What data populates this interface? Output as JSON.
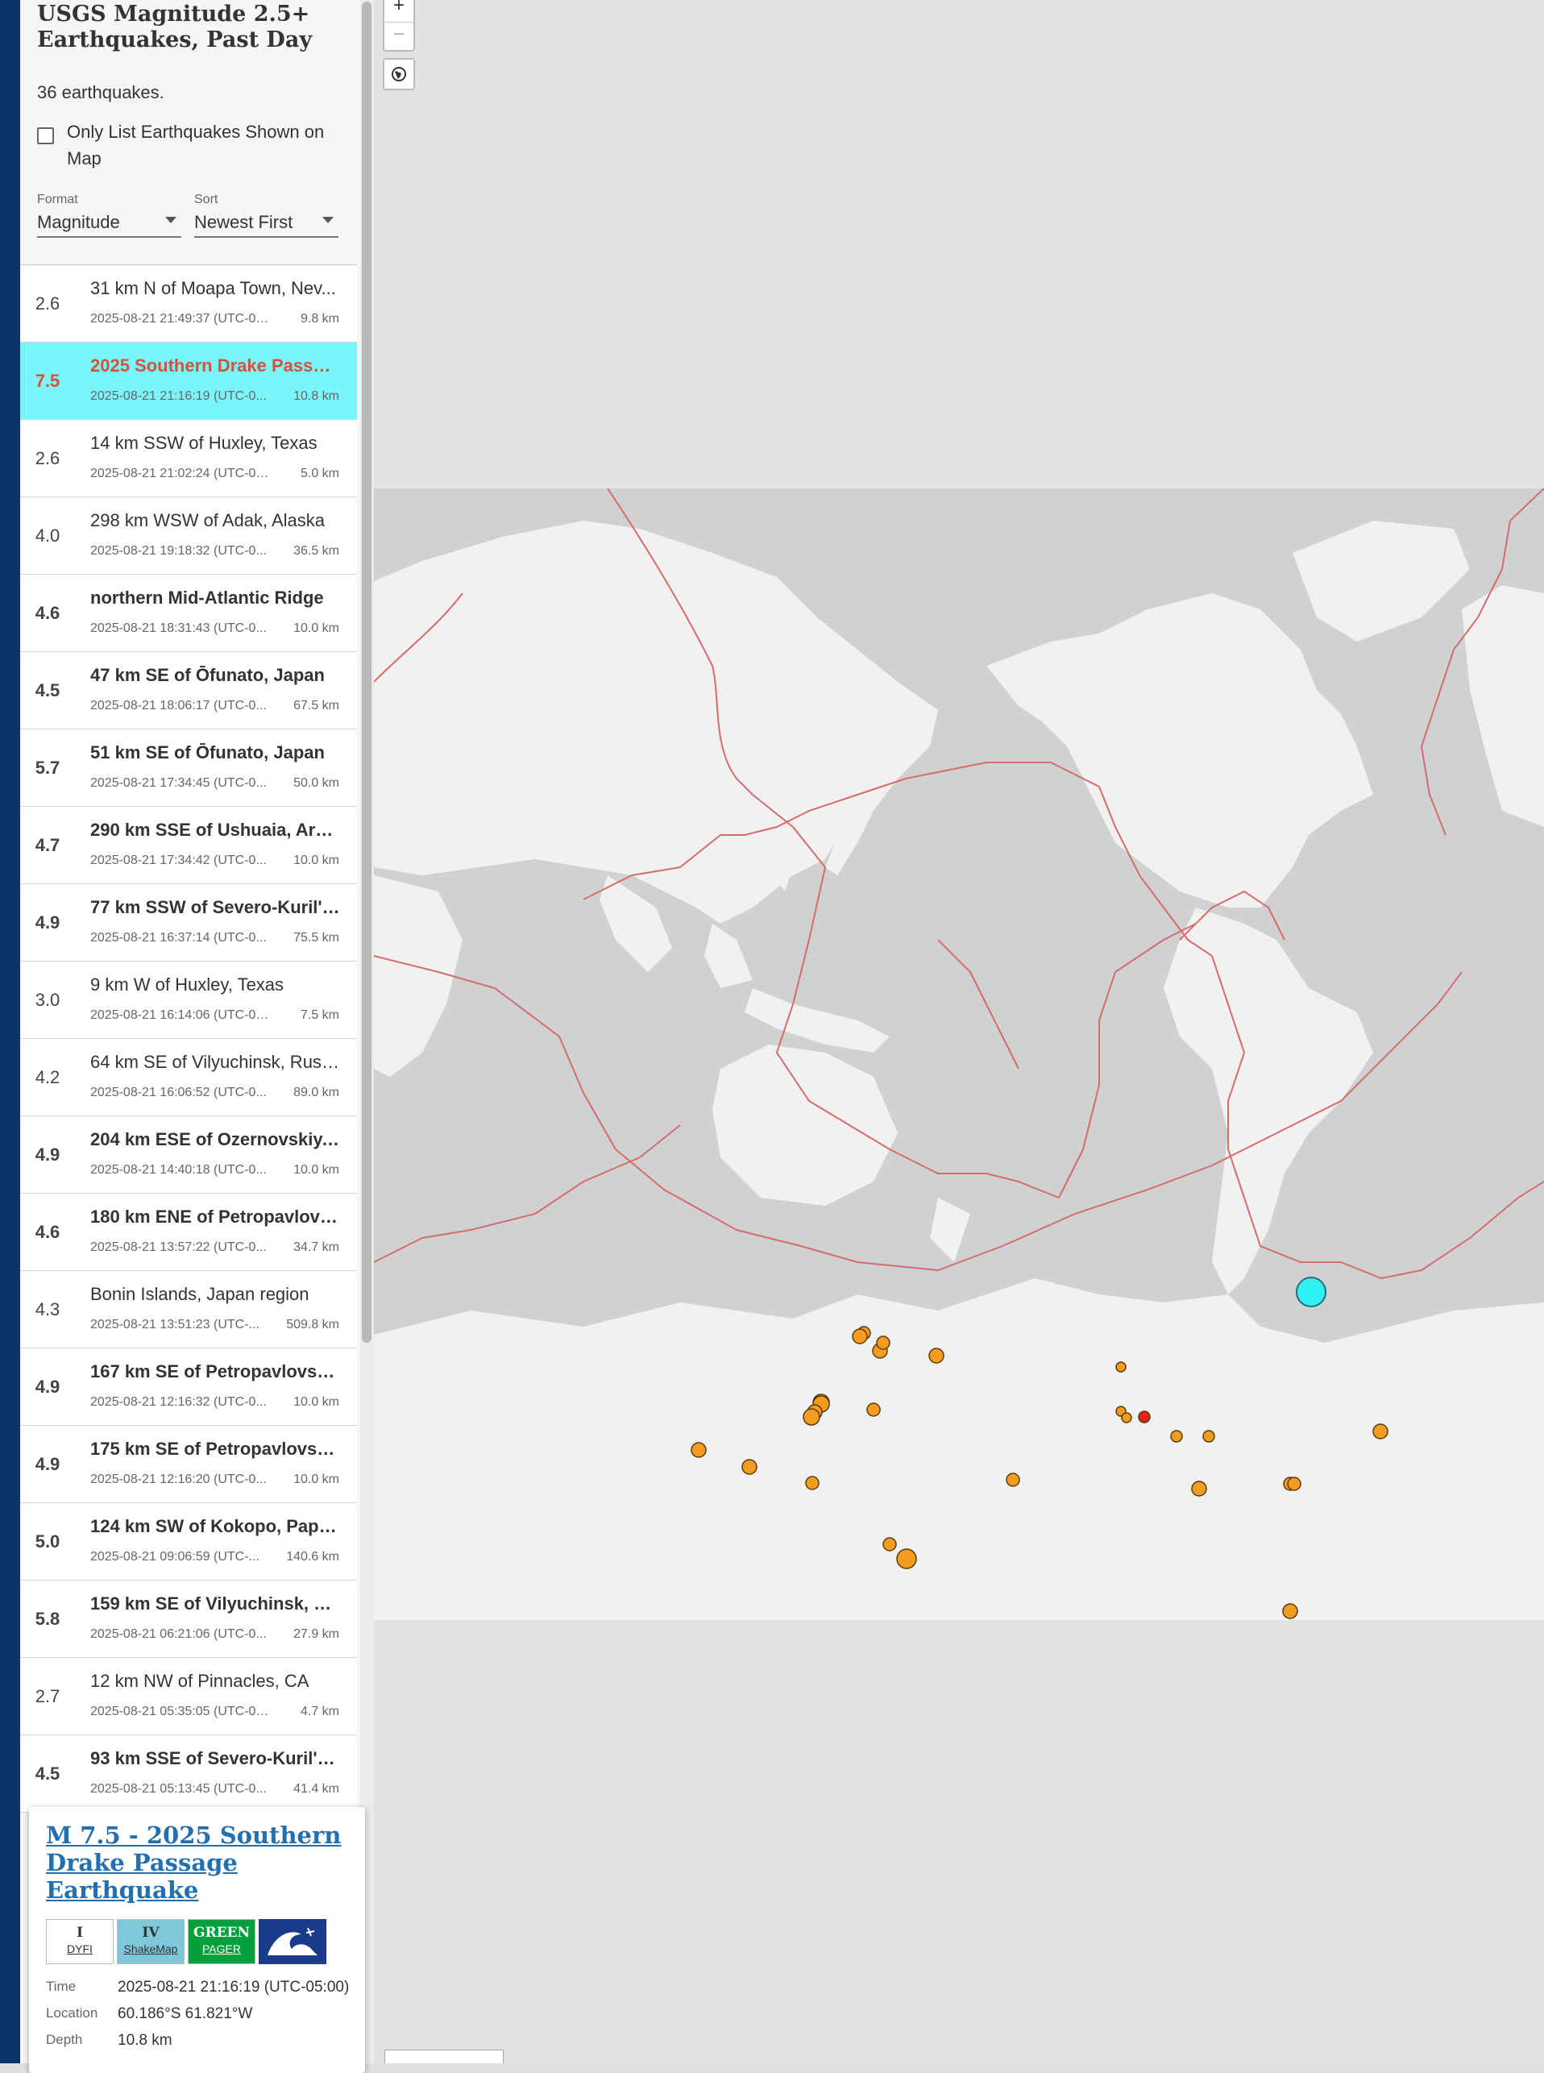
{
  "sidebar": {
    "title": "USGS Magnitude 2.5+ Earthquakes, Past Day",
    "count_text": "36 earthquakes.",
    "filter_label": "Only List Earthquakes Shown on Map",
    "format": {
      "label": "Format",
      "value": "Magnitude"
    },
    "sort": {
      "label": "Sort",
      "value": "Newest First"
    }
  },
  "earthquakes": [
    {
      "mag": "2.6",
      "place": "31 km N of Moapa Town, Nev...",
      "time": "2025-08-21 21:49:37 (UTC-05:...",
      "depth": "9.8 km"
    },
    {
      "mag": "7.5",
      "place": "2025 Southern Drake Passag...",
      "time": "2025-08-21 21:16:19 (UTC-0...",
      "depth": "10.8 km"
    },
    {
      "mag": "2.6",
      "place": "14 km SSW of Huxley, Texas",
      "time": "2025-08-21 21:02:24 (UTC-05:...",
      "depth": "5.0 km"
    },
    {
      "mag": "4.0",
      "place": "298 km WSW of Adak, Alaska",
      "time": "2025-08-21 19:18:32 (UTC-0...",
      "depth": "36.5 km"
    },
    {
      "mag": "4.6",
      "place": "northern Mid-Atlantic Ridge",
      "time": "2025-08-21 18:31:43 (UTC-0...",
      "depth": "10.0 km"
    },
    {
      "mag": "4.5",
      "place": "47 km SE of Ōfunato, Japan",
      "time": "2025-08-21 18:06:17 (UTC-0...",
      "depth": "67.5 km"
    },
    {
      "mag": "5.7",
      "place": "51 km SE of Ōfunato, Japan",
      "time": "2025-08-21 17:34:45 (UTC-0...",
      "depth": "50.0 km"
    },
    {
      "mag": "4.7",
      "place": "290 km SSE of Ushuaia, Arge...",
      "time": "2025-08-21 17:34:42 (UTC-0...",
      "depth": "10.0 km"
    },
    {
      "mag": "4.9",
      "place": "77 km SSW of Severo-Kuril's...",
      "time": "2025-08-21 16:37:14 (UTC-0...",
      "depth": "75.5 km"
    },
    {
      "mag": "3.0",
      "place": "9 km W of Huxley, Texas",
      "time": "2025-08-21 16:14:06 (UTC-05:...",
      "depth": "7.5 km"
    },
    {
      "mag": "4.2",
      "place": "64 km SE of Vilyuchinsk, Russia",
      "time": "2025-08-21 16:06:52 (UTC-0...",
      "depth": "89.0 km"
    },
    {
      "mag": "4.9",
      "place": "204 km ESE of Ozernovskiy, ...",
      "time": "2025-08-21 14:40:18 (UTC-0...",
      "depth": "10.0 km"
    },
    {
      "mag": "4.6",
      "place": "180 km ENE of Petropavlovsk...",
      "time": "2025-08-21 13:57:22 (UTC-0...",
      "depth": "34.7 km"
    },
    {
      "mag": "4.3",
      "place": "Bonin Islands, Japan region",
      "time": "2025-08-21 13:51:23 (UTC-...",
      "depth": "509.8 km"
    },
    {
      "mag": "4.9",
      "place": "167 km SE of Petropavlovsk-...",
      "time": "2025-08-21 12:16:32 (UTC-0...",
      "depth": "10.0 km"
    },
    {
      "mag": "4.9",
      "place": "175 km SE of Petropavlovsk-...",
      "time": "2025-08-21 12:16:20 (UTC-0...",
      "depth": "10.0 km"
    },
    {
      "mag": "5.0",
      "place": "124 km SW of Kokopo, Papua...",
      "time": "2025-08-21 09:06:59 (UTC-...",
      "depth": "140.6 km"
    },
    {
      "mag": "5.8",
      "place": "159 km SE of Vilyuchinsk, Ru...",
      "time": "2025-08-21 06:21:06 (UTC-0...",
      "depth": "27.9 km"
    },
    {
      "mag": "2.7",
      "place": "12 km NW of Pinnacles, CA",
      "time": "2025-08-21 05:35:05 (UTC-05:...",
      "depth": "4.7 km"
    },
    {
      "mag": "4.5",
      "place": "93 km SSE of Severo-Kuril'sk,...",
      "time": "2025-08-21 05:13:45 (UTC-0...",
      "depth": "41.4 km"
    }
  ],
  "popup": {
    "title": "M 7.5 - 2025 Southern Drake Passage Earthquake",
    "dyfi": {
      "value": "I",
      "label": "DYFI"
    },
    "shakemap": {
      "value": "IV",
      "label": "ShakeMap"
    },
    "pager": {
      "value": "GREEN",
      "label": "PAGER"
    },
    "time_label": "Time",
    "time": "2025-08-21 21:16:19 (UTC-05:00)",
    "location_label": "Location",
    "location": "60.186°S 61.821°W",
    "depth_label": "Depth",
    "depth": "10.8 km"
  },
  "map": {
    "zoom_in": "+",
    "zoom_out": "−",
    "colors": {
      "marker": "#f39c1f",
      "selected": "#2ff0f5",
      "recent": "#e8201c",
      "plate": "#d86b6b",
      "land": "#f1f1f1",
      "ocean": "#cfd1d2"
    }
  }
}
